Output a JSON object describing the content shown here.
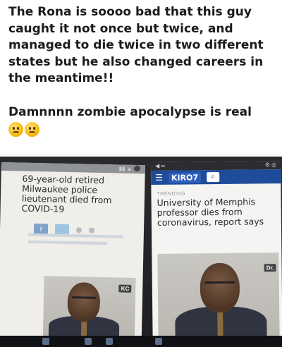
{
  "caption": {
    "line1": "The Rona is soooo bad that this guy",
    "line2": "caught it not once but twice, and",
    "line3": "managed to die twice in two different",
    "line4": "states but he also changed careers in",
    "line5": "the meantime!!",
    "line6": "Damnnnn zombie apocalypse is real"
  },
  "emojis": [
    "rofl-emoji-icon",
    "flushed-emoji-icon"
  ],
  "left_screen": {
    "headline_l1": "69-year-old retired",
    "headline_l2": "Milwaukee police",
    "headline_l3": "lieutenant died from",
    "headline_l4": "COVID-19"
  },
  "right_screen": {
    "brand": "KIRO7",
    "section": "TRENDING",
    "headline_l1": "University of Memphis",
    "headline_l2": "professor dies from",
    "headline_l3": "coronavirus, report says"
  },
  "colors": {
    "kiro_blue": "#1f4b9b",
    "caption_text": "#1c1c1c"
  }
}
